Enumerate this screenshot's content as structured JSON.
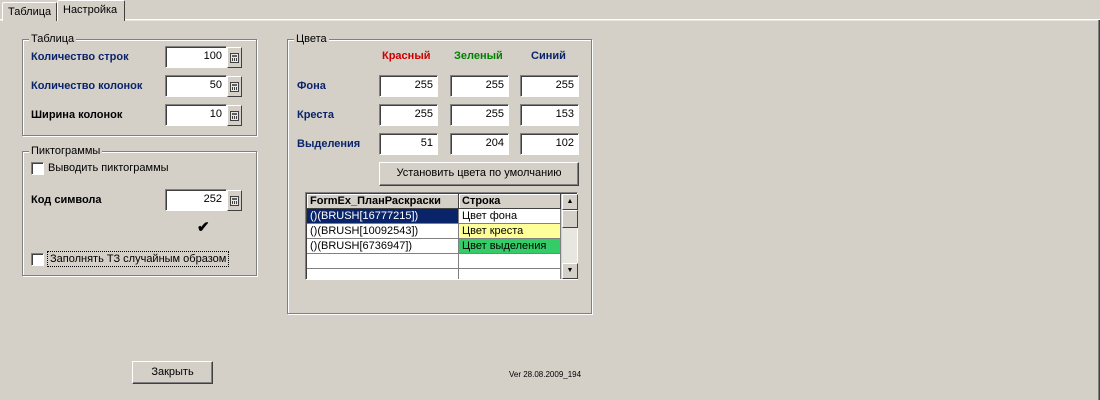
{
  "tabs": [
    {
      "label": "Таблица",
      "active": false
    },
    {
      "label": "Настройка",
      "active": true
    }
  ],
  "table_group": {
    "title": "Таблица",
    "rows_label": "Количество строк",
    "rows_value": "100",
    "cols_label": "Количество колонок",
    "cols_value": "50",
    "width_label": "Ширина колонок",
    "width_value": "10"
  },
  "icons_group": {
    "title": "Пиктограммы",
    "show_icons_label": "Выводить пиктограммы",
    "show_icons_checked": false,
    "symbol_code_label": "Код символа",
    "symbol_code_value": "252",
    "symbol_preview": "✔",
    "random_fill_label": "Заполнять ТЗ случайным образом",
    "random_fill_checked": false
  },
  "colors_group": {
    "title": "Цвета",
    "col_red": "Красный",
    "col_green": "Зеленый",
    "col_blue": "Синий",
    "row_background": {
      "label": "Фона",
      "r": "255",
      "g": "255",
      "b": "255"
    },
    "row_cross": {
      "label": "Креста",
      "r": "255",
      "g": "255",
      "b": "153"
    },
    "row_selection": {
      "label": "Выделения",
      "r": "51",
      "g": "204",
      "b": "102"
    },
    "default_button": "Установить цвета по умолчанию",
    "grid": {
      "headers": [
        "FormEx_ПланРаскраски",
        "Строка"
      ],
      "rows": [
        {
          "brush": "()(BRUSH[16777215])",
          "name": "Цвет фона",
          "color": "#ffffff"
        },
        {
          "brush": "()(BRUSH[10092543])",
          "name": "Цвет креста",
          "color": "#ffff99"
        },
        {
          "brush": "()(BRUSH[6736947])",
          "name": "Цвет выделения",
          "color": "#33cc66"
        }
      ]
    }
  },
  "colors": {
    "red_header": "#cc0000",
    "green_header": "#008000",
    "blue_header": "#0a246a",
    "selection_bg": "#0a246a"
  },
  "close_button": "Закрыть",
  "version": "Ver 28.08.2009_194"
}
